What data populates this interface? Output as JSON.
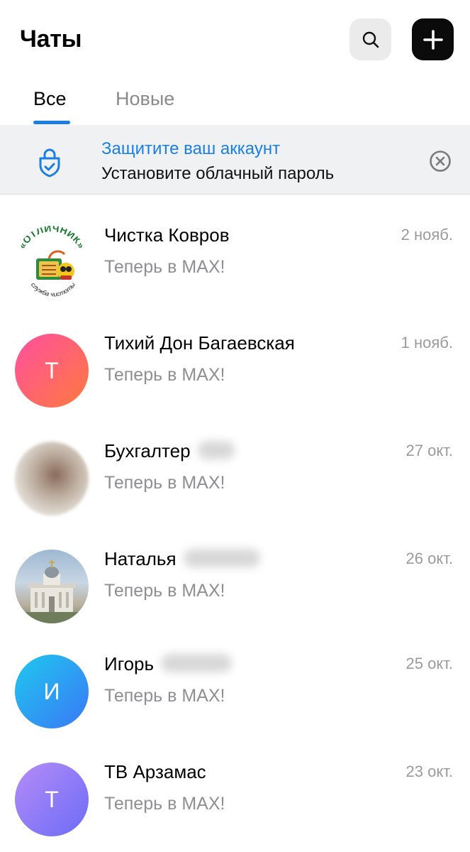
{
  "header": {
    "title": "Чаты",
    "search_icon": "search-icon",
    "add_icon": "plus-icon"
  },
  "tabs": [
    {
      "label": "Все",
      "active": true
    },
    {
      "label": "Новые",
      "active": false
    }
  ],
  "banner": {
    "title": "Защитите ваш аккаунт",
    "subtitle": "Установите облачный пароль",
    "icon": "lock-shield-icon",
    "close_icon": "close-circle-icon"
  },
  "chats": [
    {
      "name": "Чистка Ковров",
      "preview": "Теперь в MAX!",
      "time": "2 нояб.",
      "avatar_type": "logo",
      "avatar_text": "«ОТЛИЧНИК»",
      "avatar_subtext": "служба чистоты"
    },
    {
      "name": "Тихий Дон Багаевская",
      "preview": "Теперь в MAX!",
      "time": "1 нояб.",
      "avatar_type": "letter",
      "initial": "Т",
      "gradient": [
        "#ff4fa0",
        "#ff7a3d"
      ]
    },
    {
      "name": "Бухгалтер",
      "preview": "Теперь в MAX!",
      "time": "27 окт.",
      "avatar_type": "photo-blurred"
    },
    {
      "name": "Наталья",
      "preview": "Теперь в MAX!",
      "time": "26 окт.",
      "avatar_type": "photo-church"
    },
    {
      "name": "Игорь",
      "preview": "Теперь в MAX!",
      "time": "25 окт.",
      "avatar_type": "letter",
      "initial": "И",
      "gradient": [
        "#1fc8ef",
        "#3a78f5"
      ]
    },
    {
      "name": "ТВ Арзамас",
      "preview": "Теперь в MAX!",
      "time": "23 окт.",
      "avatar_type": "letter",
      "initial": "Т",
      "gradient": [
        "#b58cf8",
        "#6c6cf6"
      ]
    }
  ],
  "colors": {
    "accent": "#1a7ee6",
    "banner_bg": "#f0f1f2",
    "secondary_text": "#8e8e93"
  }
}
